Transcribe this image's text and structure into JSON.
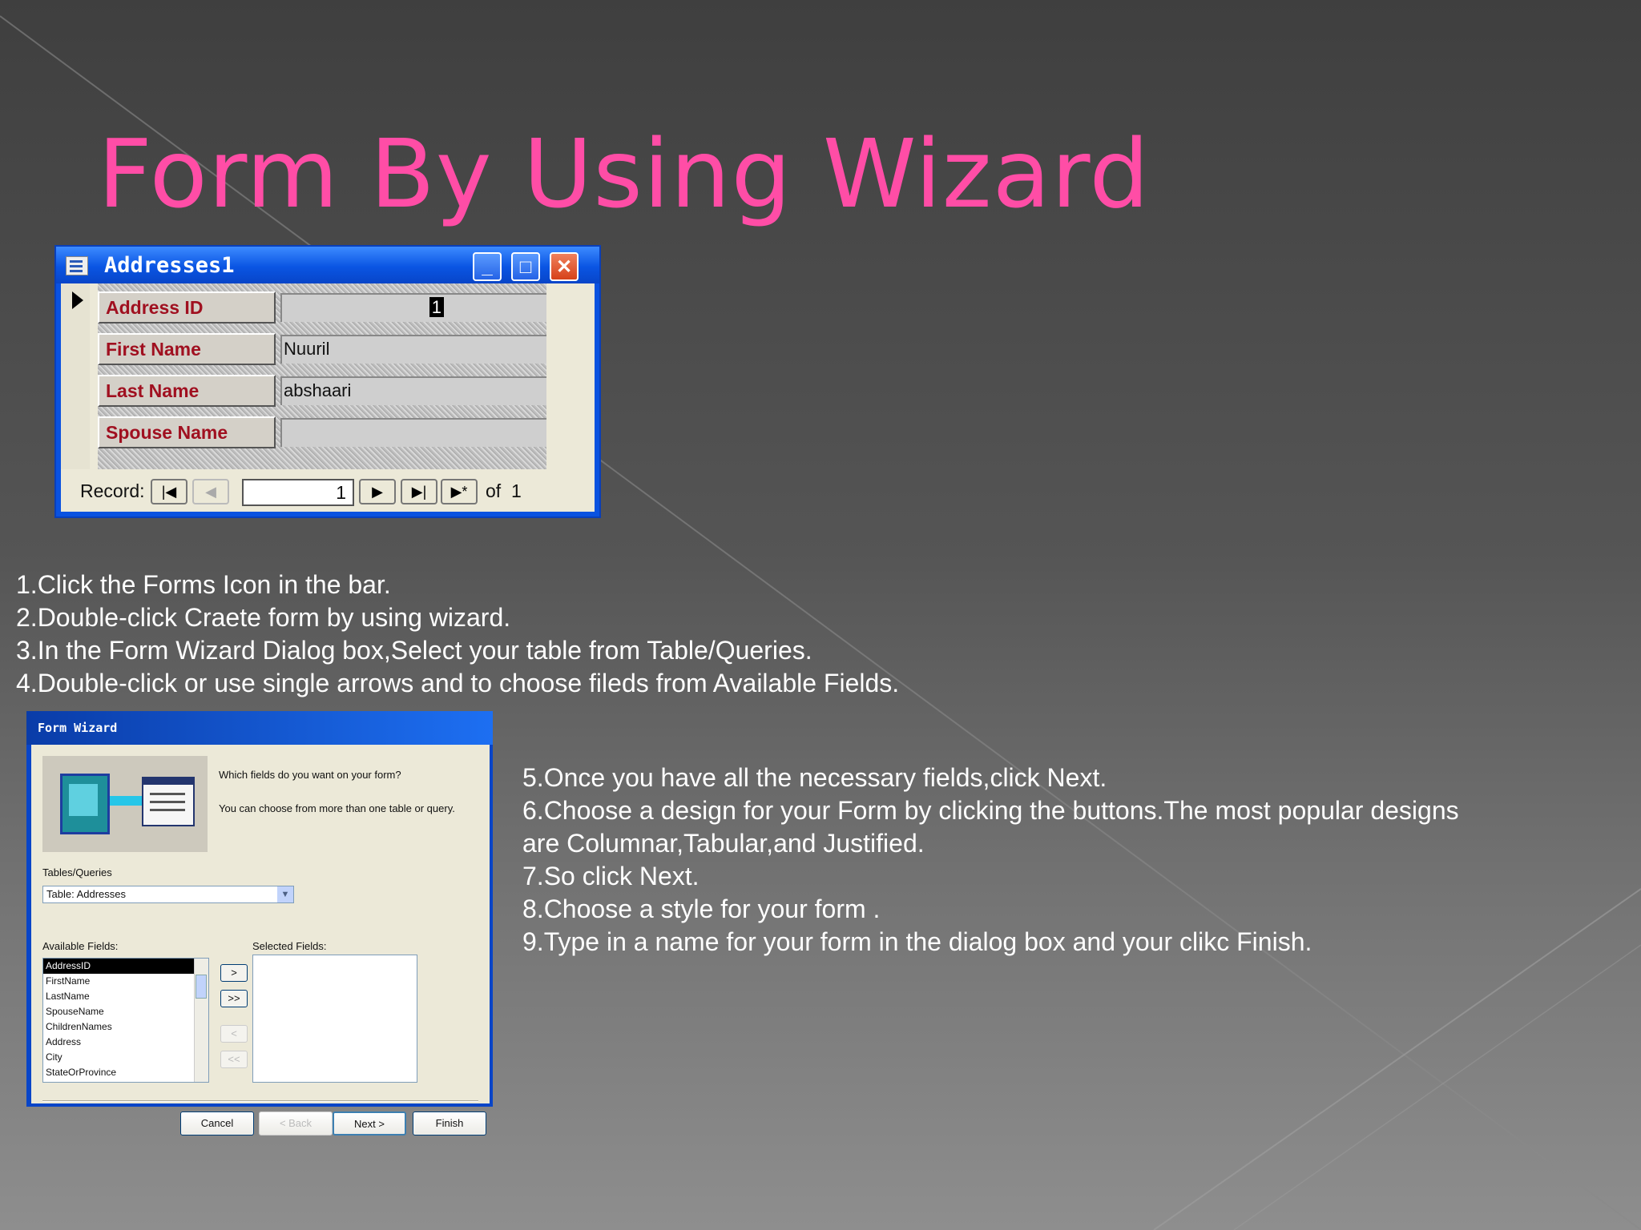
{
  "slide": {
    "title": "Form By Using Wizard"
  },
  "addresses_window": {
    "title": "Addresses1",
    "fields": [
      {
        "label": "Address ID",
        "value": "1"
      },
      {
        "label": "First Name",
        "value": "Nuuril"
      },
      {
        "label": "Last Name",
        "value": "abshaari"
      },
      {
        "label": "Spouse Name",
        "value": ""
      }
    ],
    "navigation": {
      "record_label": "Record:",
      "current": "1",
      "of_label": "of",
      "total": "1"
    }
  },
  "steps_part1": [
    "1.Click the Forms Icon in the bar.",
    "2.Double-click Craete form by using wizard.",
    "3.In the Form Wizard Dialog box,Select your table from Table/Queries.",
    "4.Double-click or use single arrows and to choose fileds from Available Fields."
  ],
  "form_wizard": {
    "title": "Form Wizard",
    "question": "Which fields do you want on your form?",
    "hint": "You can choose from more than one table or query.",
    "tables_label": "Tables/Queries",
    "table_value": "Table: Addresses",
    "available_label": "Available Fields:",
    "selected_label": "Selected Fields:",
    "available_fields": [
      "AddressID",
      "FirstName",
      "LastName",
      "SpouseName",
      "ChildrenNames",
      "Address",
      "City",
      "StateOrProvince"
    ],
    "move_buttons": [
      ">",
      ">>",
      "<",
      "<<"
    ],
    "buttons": {
      "cancel": "Cancel",
      "back": "< Back",
      "next": "Next >",
      "finish": "Finish"
    }
  },
  "steps_part2": [
    "5.Once you have all the necessary fields,click Next.",
    "6.Choose a design for your Form by clicking the buttons.The most popular designs are Columnar,Tabular,and Justified.",
    "7.So click Next.",
    "8.Choose a style for your form .",
    "9.Type in a name for your form in the dialog box and your clikc Finish."
  ],
  "colors": {
    "title": "#ff4da6",
    "text": "#ffffff",
    "xp_blue": "#0a55e3",
    "field_label": "#a01020"
  }
}
